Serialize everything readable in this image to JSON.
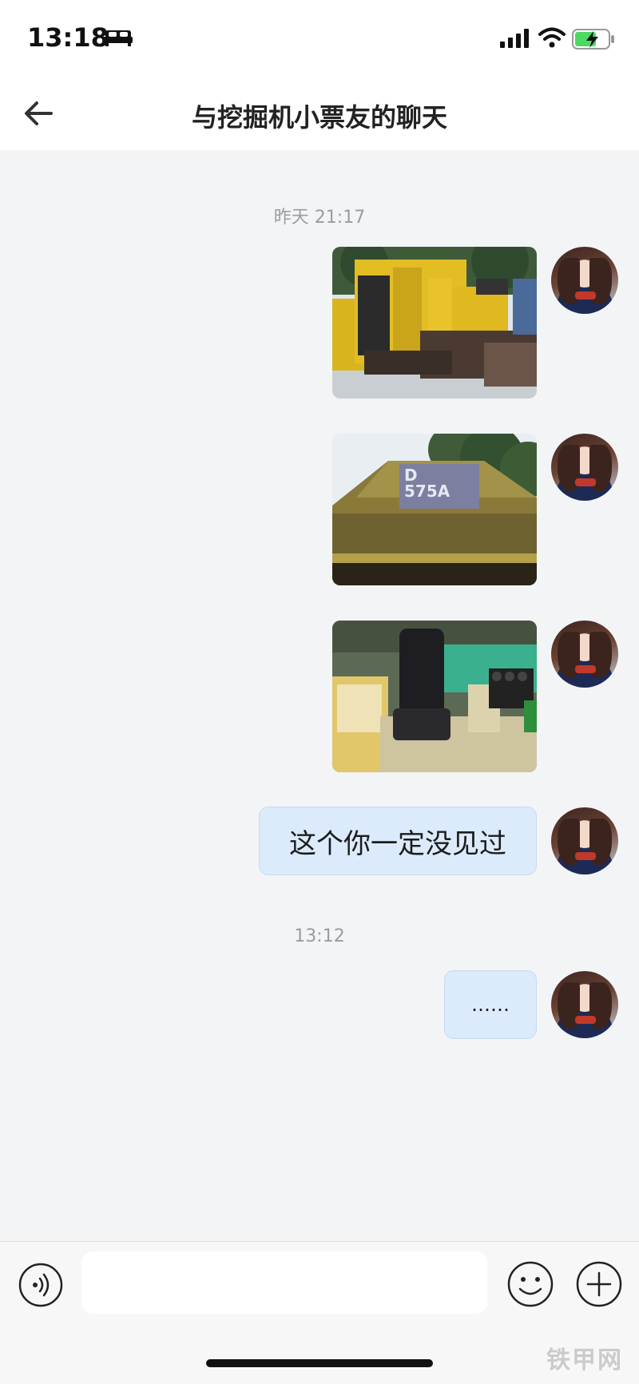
{
  "status_bar": {
    "time": "13:18",
    "icons": [
      "bed-icon",
      "cellular-signal-icon",
      "wifi-icon",
      "battery-charging-icon"
    ],
    "battery_color": "#4cd964"
  },
  "nav": {
    "title": "与挖掘机小票友的聊天",
    "back_icon": "arrow-left-icon"
  },
  "messages": [
    {
      "type": "timestamp",
      "text": "昨天 21:17"
    },
    {
      "type": "image",
      "sender": "self",
      "subject": "yellow bulldozer front"
    },
    {
      "type": "image",
      "sender": "self",
      "subject": "bulldozer hood D575A"
    },
    {
      "type": "image",
      "sender": "self",
      "subject": "bulldozer operator seat"
    },
    {
      "type": "text",
      "sender": "self",
      "text": "这个你一定没见过"
    },
    {
      "type": "timestamp",
      "text": "13:12"
    },
    {
      "type": "text",
      "sender": "self",
      "text": "……"
    }
  ],
  "photo_labels": {
    "hood_model": "D\n575A"
  },
  "input_bar": {
    "value": "",
    "placeholder": "",
    "voice_icon": "voice-icon",
    "emoji_icon": "emoji-icon",
    "plus_icon": "plus-icon"
  },
  "watermark": "铁甲网",
  "colors": {
    "background": "#f3f4f6",
    "bubble": "#dcebfb",
    "bubble_border": "#c5daf0",
    "timestamp": "#9a9ca3"
  }
}
